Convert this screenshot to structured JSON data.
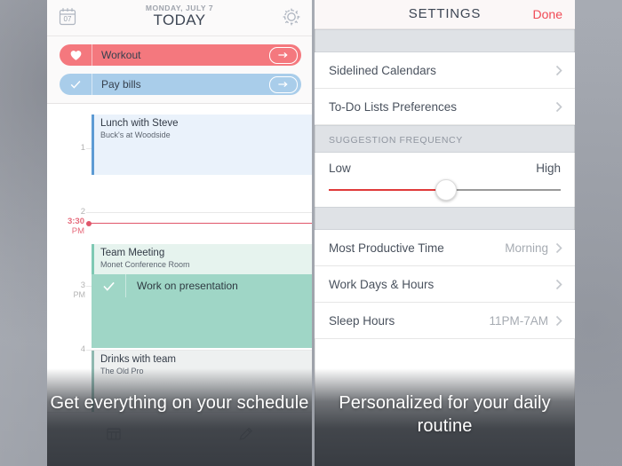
{
  "left_panel": {
    "header": {
      "date": "MONDAY, JULY 7",
      "title": "TODAY",
      "calendar_icon_day": "07",
      "calendar_icon": "calendar-icon",
      "settings_icon": "gear-icon"
    },
    "suggestions": [
      {
        "label": "Workout",
        "icon": "heart-icon",
        "action_icon": "arrow-right-icon",
        "color": "#f4787e"
      },
      {
        "label": "Pay bills",
        "icon": "check-icon",
        "action_icon": "arrow-right-icon",
        "color": "#a9cdea"
      }
    ],
    "hour_labels": [
      {
        "hour": "1",
        "ampm": ""
      },
      {
        "hour": "2",
        "ampm": ""
      },
      {
        "hour": "3",
        "ampm": "PM"
      },
      {
        "hour": "4",
        "ampm": ""
      }
    ],
    "now_indicator": {
      "time": "3:30",
      "ampm": "PM",
      "color": "#e0566a"
    },
    "events": [
      {
        "title": "Lunch with Steve",
        "subtitle": "Buck's at Woodside",
        "color": "#5d9bd4"
      },
      {
        "title": "Team Meeting",
        "subtitle": "Monet Conference Room",
        "color": "#7fc9b4"
      },
      {
        "title": "Drinks with team",
        "subtitle": "The Old Pro",
        "color": "#8fb8b0"
      }
    ],
    "todo": {
      "label": "Work on presentation",
      "icon": "check-icon",
      "color": "#9fd6c6"
    },
    "toolbar": [
      {
        "icon": "calendar-icon",
        "label": ""
      },
      {
        "icon": "pencil-icon",
        "label": ""
      }
    ],
    "caption": "Get everything on your schedule"
  },
  "right_panel": {
    "header": {
      "title": "SETTINGS",
      "done_label": "Done",
      "done_color": "#f04a55"
    },
    "rows_top": [
      {
        "label": "Sidelined Calendars",
        "value": "",
        "chevron": "chevron-right-icon"
      },
      {
        "label": "To-Do Lists Preferences",
        "value": "",
        "chevron": "chevron-right-icon"
      }
    ],
    "frequency_section": {
      "header": "SUGGESTION FREQUENCY",
      "low_label": "Low",
      "high_label": "High",
      "value_percent": 50,
      "fill_color": "#e03a3a",
      "track_color": "#9a9a9a"
    },
    "rows_bottom": [
      {
        "label": "Most Productive Time",
        "value": "Morning",
        "chevron": "chevron-right-icon"
      },
      {
        "label": "Work Days & Hours",
        "value": "",
        "chevron": "chevron-right-icon"
      },
      {
        "label": "Sleep Hours",
        "value": "11PM-7AM",
        "chevron": "chevron-right-icon"
      }
    ],
    "caption": "Personalized for your daily routine"
  }
}
